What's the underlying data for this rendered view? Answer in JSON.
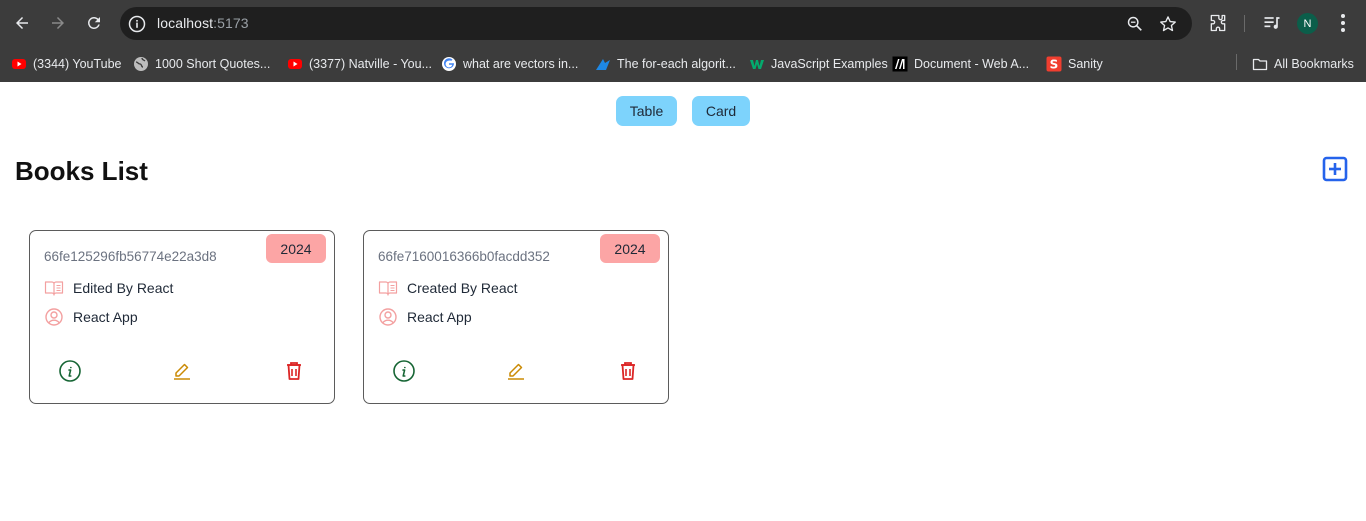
{
  "browser": {
    "url_host": "localhost",
    "url_port": ":5173",
    "profile_initial": "N",
    "bookmarks": [
      {
        "label": "(3344) YouTube",
        "icon": "youtube-icon"
      },
      {
        "label": "1000 Short Quotes...",
        "icon": "globe-icon"
      },
      {
        "label": "(3377) Natville - You...",
        "icon": "youtube-icon"
      },
      {
        "label": "what are vectors in...",
        "icon": "google-icon"
      },
      {
        "label": "The for-each algorit...",
        "icon": "bird-icon"
      },
      {
        "label": "JavaScript Examples",
        "icon": "w3schools-icon"
      },
      {
        "label": "Document - Web A...",
        "icon": "mdn-icon"
      },
      {
        "label": "Sanity",
        "icon": "sanity-icon"
      }
    ],
    "all_bookmarks_label": "All Bookmarks"
  },
  "page": {
    "view_toggle": {
      "table_label": "Table",
      "card_label": "Card"
    },
    "title": "Books List",
    "cards": [
      {
        "id": "66fe125296fb56774e22a3d8",
        "year": "2024",
        "title": "Edited By React",
        "author": "React App"
      },
      {
        "id": "66fe7160016366b0facdd352",
        "year": "2024",
        "title": "Created By React",
        "author": "React App"
      }
    ]
  },
  "colors": {
    "toggle_bg": "#7dd3fc",
    "badge_bg": "#fca5a5",
    "add_icon": "#2563eb",
    "info_icon": "#166534",
    "edit_icon": "#ca8a04",
    "delete_icon": "#dc2626",
    "card_icon": "#f3a0a0"
  }
}
